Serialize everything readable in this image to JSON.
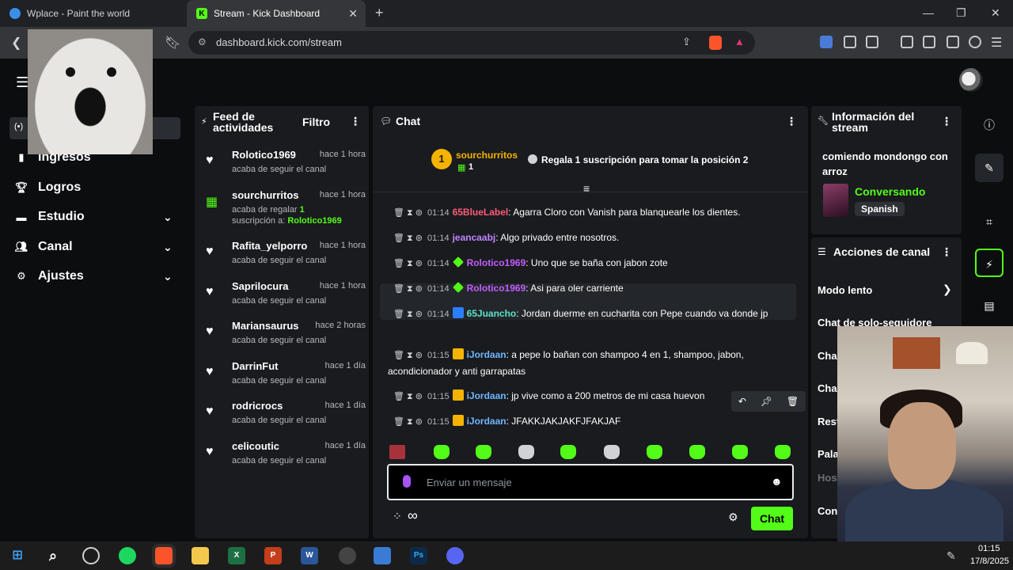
{
  "browser": {
    "tabs": [
      {
        "title": "Wplace - Paint the world",
        "active": false
      },
      {
        "title": "Stream - Kick Dashboard",
        "active": true
      }
    ],
    "url": "dashboard.kick.com/stream"
  },
  "sidebar": {
    "items": [
      {
        "label": "Ingresos",
        "icon": "chart-icon"
      },
      {
        "label": "Logros",
        "icon": "trophy-icon"
      },
      {
        "label": "Estudio",
        "icon": "studio-icon"
      },
      {
        "label": "Canal",
        "icon": "people-icon"
      },
      {
        "label": "Ajustes",
        "icon": "gear-icon"
      }
    ]
  },
  "feed": {
    "title": "Feed de actividades",
    "filter": "Filtro",
    "items": [
      {
        "name": "Rolotico1969",
        "time": "hace 1 hora",
        "desc": "acaba de seguir el canal",
        "icon": "heart-icon"
      },
      {
        "name": "sourchurritos",
        "time": "hace 1 hora",
        "desc": "acaba de regalar ",
        "count": "1",
        "desc2": " suscripción a: ",
        "target": "Rolotico1969",
        "icon": "gift-icon"
      },
      {
        "name": "Rafita_yelporro",
        "time": "hace 1 hora",
        "desc": "acaba de seguir el canal",
        "icon": "heart-icon"
      },
      {
        "name": "Saprilocura",
        "time": "hace 1 hora",
        "desc": "acaba de seguir el canal",
        "icon": "heart-icon"
      },
      {
        "name": "Mariansaurus",
        "time": "hace 2 horas",
        "desc": "acaba de seguir el canal",
        "icon": "heart-icon"
      },
      {
        "name": "DarrinFut",
        "time": "hace 1 día",
        "desc": "acaba de seguir el canal",
        "icon": "heart-icon"
      },
      {
        "name": "rodricrocs",
        "time": "hace 1 día",
        "desc": "acaba de seguir el canal",
        "icon": "heart-icon"
      },
      {
        "name": "celicoutic",
        "time": "hace 1 día",
        "desc": "acaba de seguir el canal",
        "icon": "heart-icon"
      }
    ]
  },
  "chat": {
    "title": "Chat",
    "leader": {
      "rank": "1",
      "name": "sourchurritos",
      "count": "1",
      "cta": "Regala 1 suscripción para tomar la posición 2"
    },
    "messages": [
      {
        "time": "01:14",
        "user": "65BlueLabel",
        "color": "#ff5c7a",
        "badge": "",
        "text": ": Agarra Cloro con Vanish para blanquearle los dientes."
      },
      {
        "time": "01:14",
        "user": "jeancaabj",
        "color": "#c084fc",
        "badge": "",
        "text": ": Algo privado entre nosotros."
      },
      {
        "time": "01:14",
        "user": "Rolotico1969",
        "color": "#c45cff",
        "badge": "#53fc18",
        "text": ": Uno que se baña con jabon zote"
      },
      {
        "time": "01:14",
        "user": "Rolotico1969",
        "color": "#c45cff",
        "badge": "#53fc18",
        "text": ": Asi para oler carriente"
      },
      {
        "time": "01:14",
        "user": "65Juancho",
        "color": "#5be3c8",
        "badge": "#2b7fff",
        "text": ": Jordan duerme en cucharita con Pepe cuando va donde jp"
      },
      {
        "time": "01:15",
        "user": "iJordaan",
        "color": "#6fb6ff",
        "badge": "#f5b301",
        "text": ": a pepe lo bañan con shampoo 4 en 1, shampoo, jabon, acondicionador y anti garrapatas"
      },
      {
        "time": "01:15",
        "user": "iJordaan",
        "color": "#6fb6ff",
        "badge": "#f5b301",
        "text": ": jp vive como a 200 metros de mi casa huevon"
      },
      {
        "time": "01:15",
        "user": "iJordaan",
        "color": "#6fb6ff",
        "badge": "#f5b301",
        "text": ": JFAKKJAKJAKFJFAKJAF"
      }
    ],
    "input_placeholder": "Enviar un mensaje",
    "send_label": "Chat",
    "infinity": "∞"
  },
  "stream_info": {
    "title": "Información del stream",
    "stream_title": "comiendo mondongo con arroz",
    "category": "Conversando",
    "language": "Spanish"
  },
  "channel_actions": {
    "title": "Acciones de canal",
    "items": [
      "Modo lento",
      "Chat de solo-seguidore",
      "Cha",
      "Cha",
      "Rest",
      "Pala",
      "Hos",
      "Con"
    ]
  },
  "taskbar": {
    "time": "01:15",
    "date": "17/8/2025"
  },
  "colors": {
    "kick_green": "#53fc18",
    "panel_bg": "#191b1f",
    "page_bg": "#0b0d0f"
  }
}
